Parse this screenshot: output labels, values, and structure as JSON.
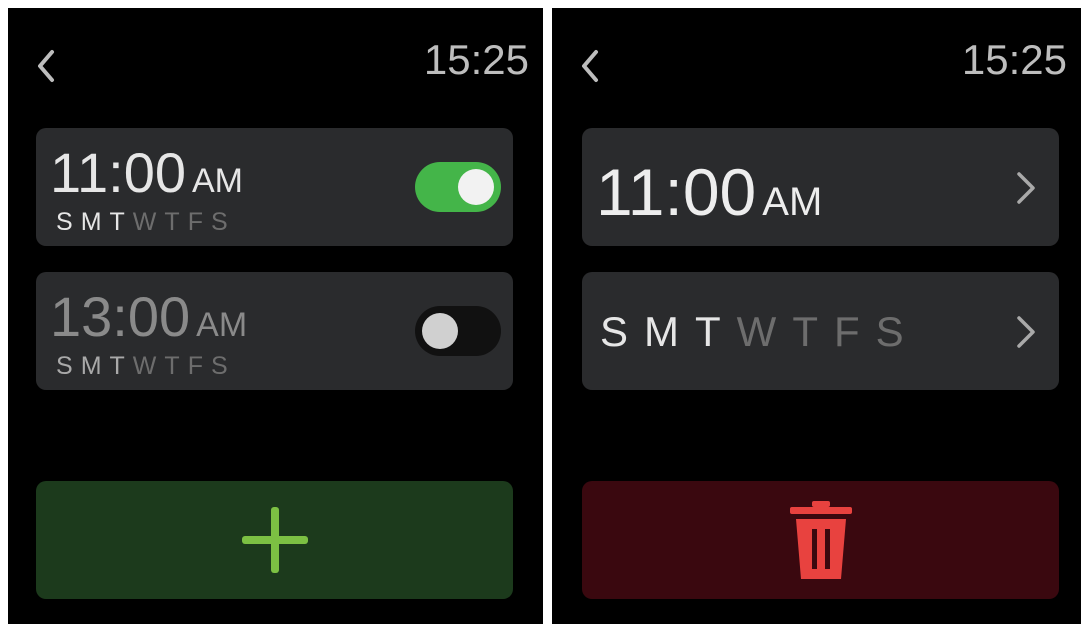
{
  "left_screen": {
    "clock": "15:25",
    "alarms": [
      {
        "time": "11:00",
        "ampm": "AM",
        "enabled": true,
        "days": [
          {
            "label": "S",
            "active": true
          },
          {
            "label": "M",
            "active": true
          },
          {
            "label": "T",
            "active": true
          },
          {
            "label": "W",
            "active": false
          },
          {
            "label": "T",
            "active": false
          },
          {
            "label": "F",
            "active": false
          },
          {
            "label": "S",
            "active": false
          }
        ]
      },
      {
        "time": "13:00",
        "ampm": "AM",
        "enabled": false,
        "days": [
          {
            "label": "S",
            "active": true
          },
          {
            "label": "M",
            "active": true
          },
          {
            "label": "T",
            "active": true
          },
          {
            "label": "W",
            "active": false
          },
          {
            "label": "T",
            "active": false
          },
          {
            "label": "F",
            "active": false
          },
          {
            "label": "S",
            "active": false
          }
        ]
      }
    ],
    "add_button_icon": "plus-icon"
  },
  "right_screen": {
    "clock": "15:25",
    "time_row": {
      "time": "11:00",
      "ampm": "AM"
    },
    "days_row": [
      {
        "label": "S",
        "active": true
      },
      {
        "label": "M",
        "active": true
      },
      {
        "label": "T",
        "active": true
      },
      {
        "label": "W",
        "active": false
      },
      {
        "label": "T",
        "active": false
      },
      {
        "label": "F",
        "active": false
      },
      {
        "label": "S",
        "active": false
      }
    ],
    "delete_button_icon": "trash-icon"
  },
  "colors": {
    "toggle_on": "#44b549",
    "add_bg": "#1c3a1c",
    "add_icon": "#7cc043",
    "delete_bg": "#3a080f",
    "delete_icon": "#e8423f"
  }
}
